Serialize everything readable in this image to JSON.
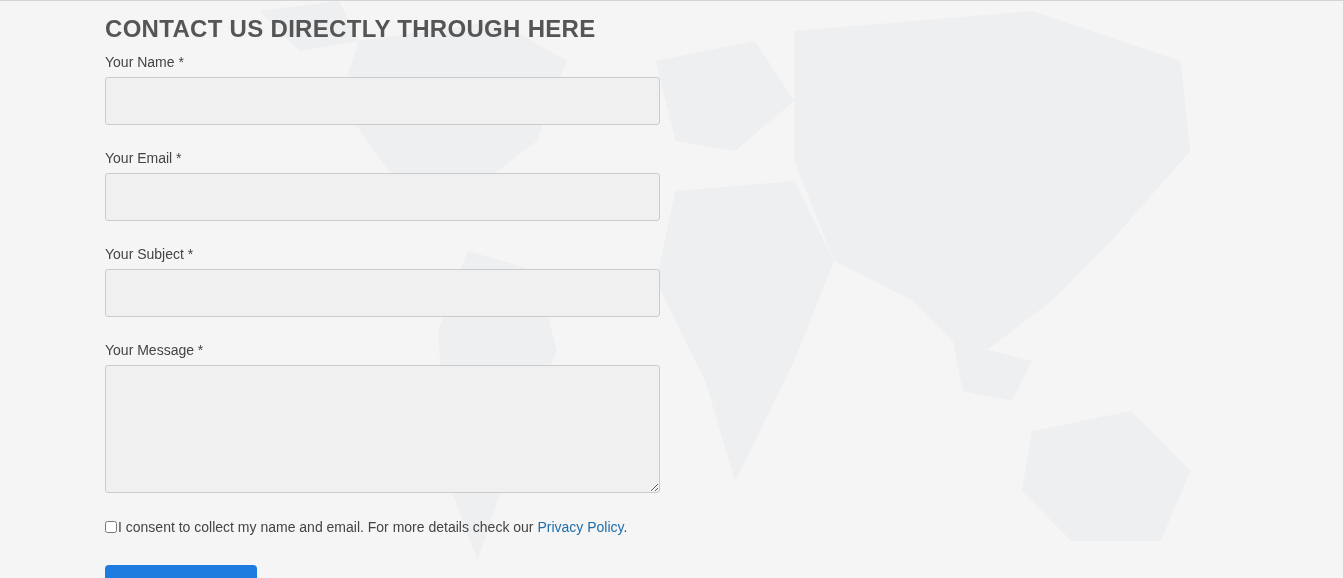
{
  "heading": "CONTACT US DIRECTLY THROUGH HERE",
  "fields": [
    {
      "label": "Your Name *",
      "kind": "input"
    },
    {
      "label": "Your Email *",
      "kind": "input"
    },
    {
      "label": "Your Subject *",
      "kind": "input"
    },
    {
      "label": "Your Message *",
      "kind": "textarea"
    }
  ],
  "consent": {
    "checked": false,
    "text": "I consent to collect my name and email. For more details check our ",
    "link": "Privacy Policy",
    "after": "."
  },
  "submit": {
    "kind": "button"
  }
}
